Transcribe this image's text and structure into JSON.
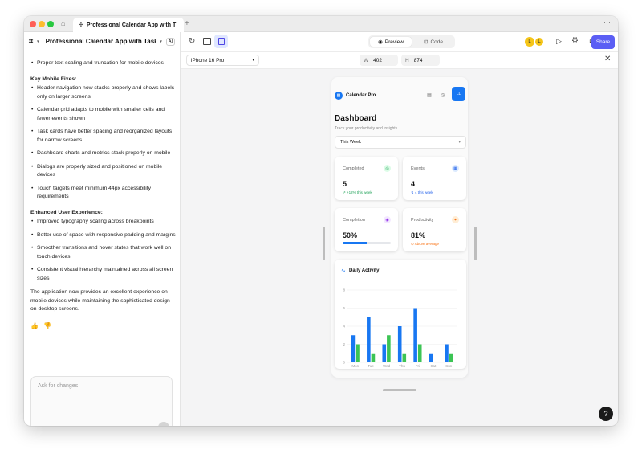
{
  "browser": {
    "tab_title": "Professional Calendar App with T",
    "new_tab": "+",
    "more": "···"
  },
  "left_panel": {
    "project_title": "Professional Calendar App with Task ...",
    "ai_badge": "AI",
    "intro_fragment": "Proper text scaling and truncation for mobile devices",
    "sections": [
      {
        "heading": "Key Mobile Fixes:",
        "items": [
          "Header navigation now stacks properly and shows labels only on larger screens",
          "Calendar grid adapts to mobile with smaller cells and fewer events shown",
          "Task cards have better spacing and reorganized layouts for narrow screens",
          "Dashboard charts and metrics stack properly on mobile",
          "Dialogs are properly sized and positioned on mobile devices",
          "Touch targets meet minimum 44px accessibility requirements"
        ]
      },
      {
        "heading": "Enhanced User Experience:",
        "items": [
          "Improved typography scaling across breakpoints",
          "Better use of space with responsive padding and margins",
          "Smoother transitions and hover states that work well on touch devices",
          "Consistent visual hierarchy maintained across all screen sizes"
        ]
      }
    ],
    "closing": "The application now provides an excellent experience on mobile devices while maintaining the sophisticated design on desktop screens.",
    "chat_placeholder": "Ask for changes"
  },
  "toolbar": {
    "preview_label": "Preview",
    "code_label": "Code",
    "avatar1": "L",
    "avatar2": "L",
    "publish_label": "Publish",
    "share_label": "Share"
  },
  "device_bar": {
    "device": "iPhone 16 Pro",
    "width_label": "W",
    "width_value": "402",
    "height_label": "H",
    "height_value": "874"
  },
  "app": {
    "brand": "Calendar Pro",
    "title": "Dashboard",
    "subtitle": "Track your productivity and insights",
    "range_select": "This Week",
    "user_initials": "LL",
    "metrics": [
      {
        "label": "Completed",
        "value": "5",
        "sub": "↗ +12% this week",
        "color": "#22a35a",
        "icon_bg": "#dcfce7"
      },
      {
        "label": "Events",
        "value": "4",
        "sub": "↯ 4 this week",
        "color": "#2563eb",
        "icon_bg": "#dbeafe"
      },
      {
        "label": "Completion",
        "value": "50%",
        "progress": 0.5,
        "color": "#9333ea",
        "icon_bg": "#f3e8ff"
      },
      {
        "label": "Productivity",
        "value": "81%",
        "sub": "⊙ Above average",
        "color": "#f97316",
        "icon_bg": "#ffedd5"
      }
    ],
    "activity_title": "Daily Activity"
  },
  "chart_data": {
    "type": "bar",
    "title": "Daily Activity",
    "categories": [
      "Mon",
      "Tue",
      "Wed",
      "Thu",
      "Fri",
      "Sat",
      "Sun"
    ],
    "series": [
      {
        "values": [
          3,
          5,
          2,
          4,
          6,
          1,
          2
        ],
        "color": "#1877f2"
      },
      {
        "values": [
          2,
          1,
          3,
          1,
          2,
          0,
          1
        ],
        "color": "#3cc454"
      }
    ],
    "ylim": [
      0,
      8
    ],
    "yticks": [
      0,
      2,
      4,
      6,
      8
    ],
    "grid": true
  },
  "help": "?"
}
